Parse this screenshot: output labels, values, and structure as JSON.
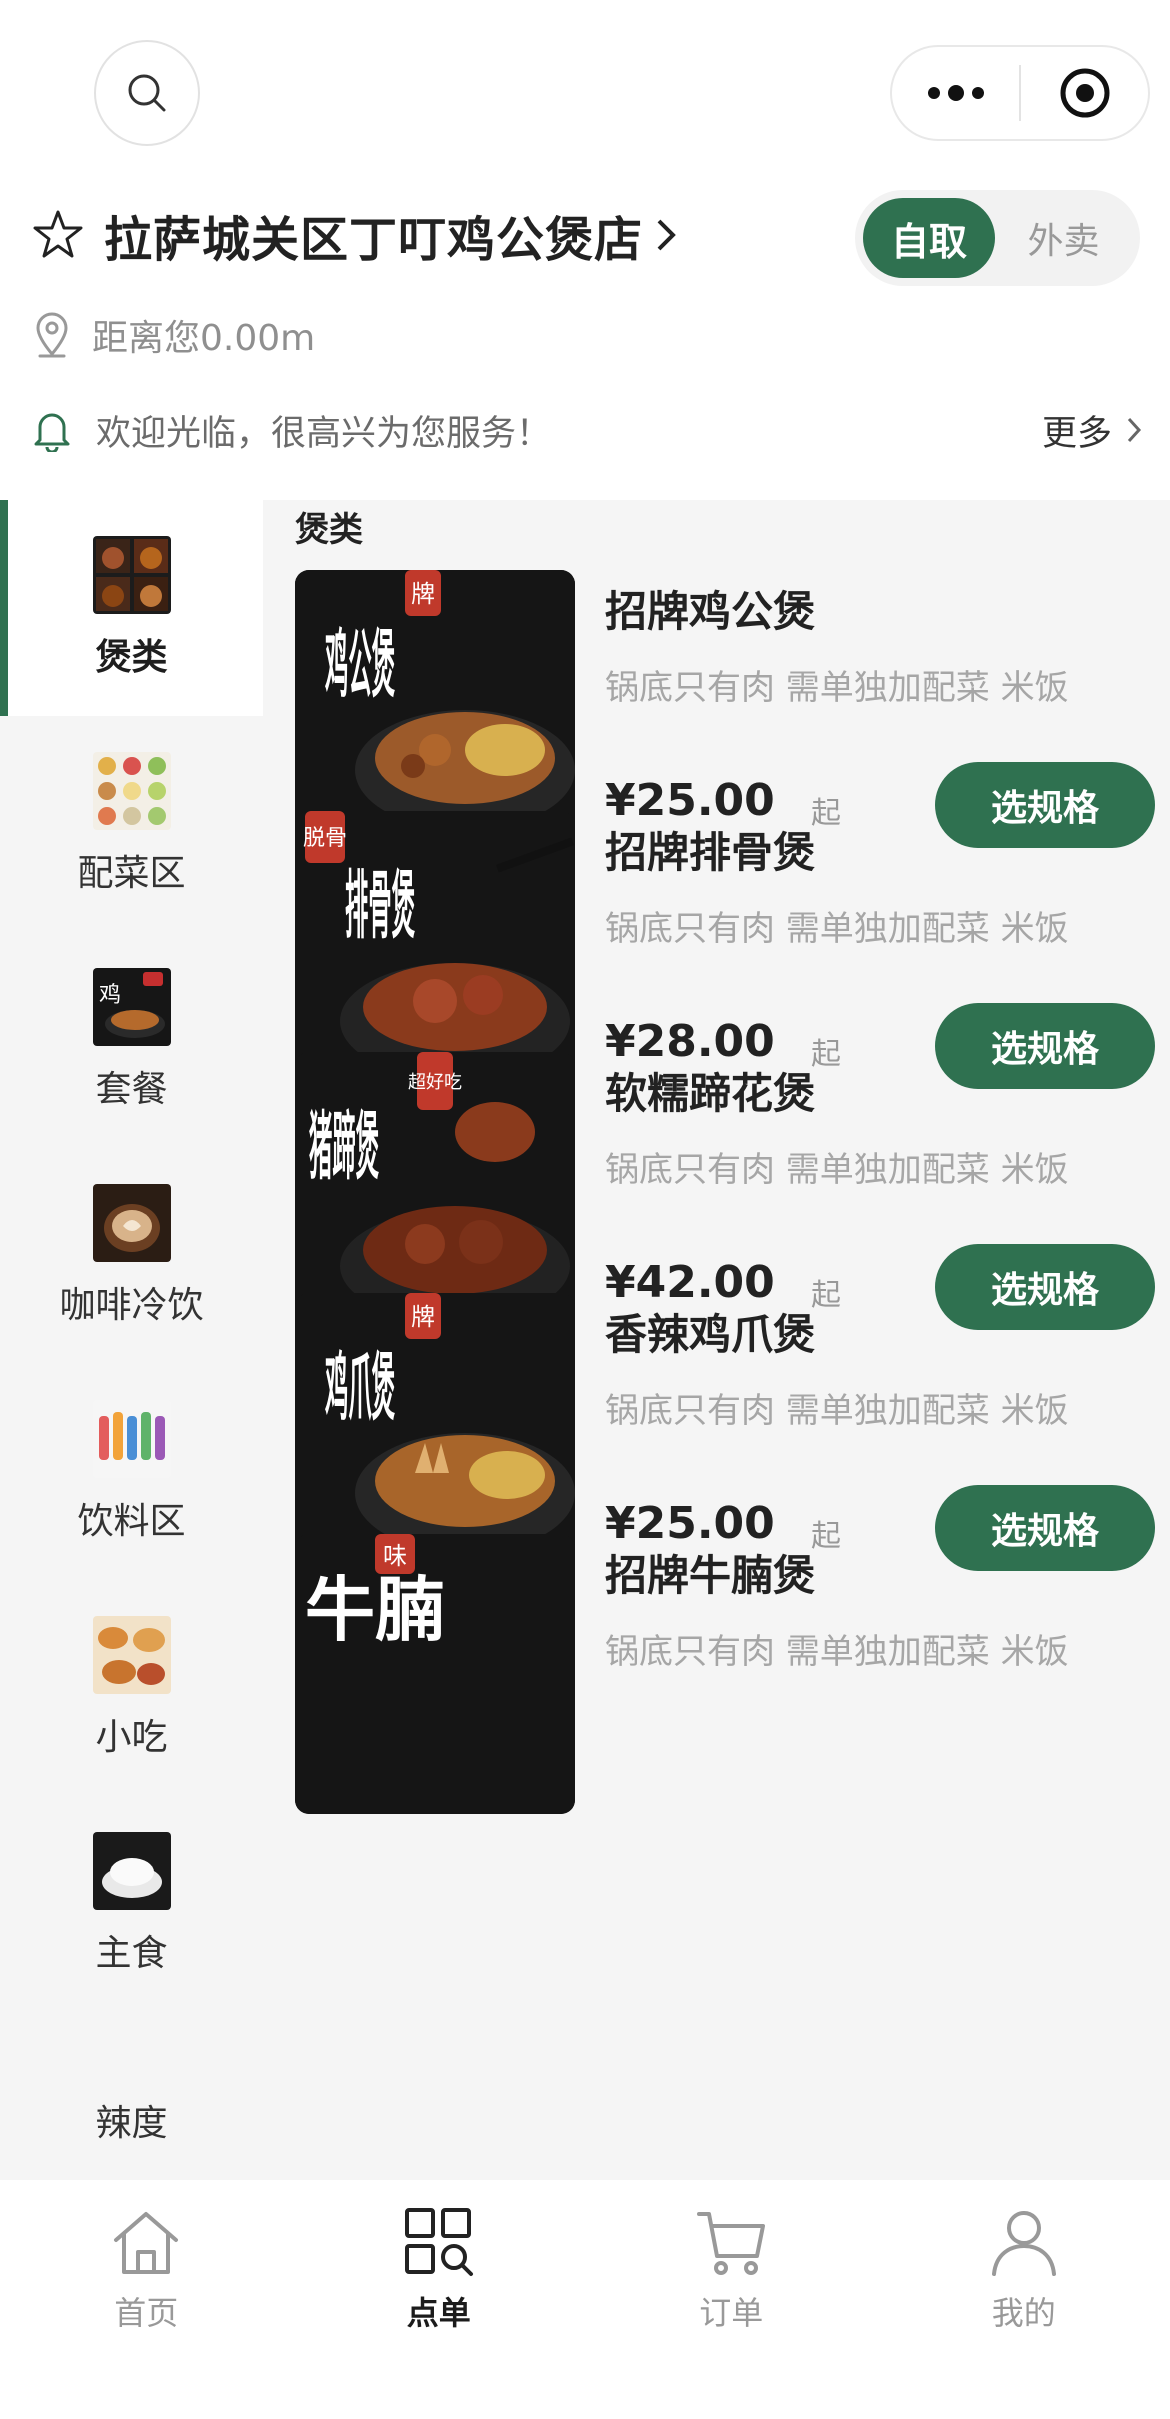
{
  "header": {
    "store_name": "拉萨城关区丁叮鸡公煲店",
    "distance": "距离您0.00m",
    "notice": "欢迎光临，很高兴为您服务！",
    "more": "更多",
    "mode_active": "自取",
    "mode_inactive": "外卖"
  },
  "sidebar": {
    "items": [
      {
        "label": "煲类",
        "active": true
      },
      {
        "label": "配菜区"
      },
      {
        "label": "套餐"
      },
      {
        "label": "咖啡冷饮"
      },
      {
        "label": "饮料区"
      },
      {
        "label": "小吃"
      },
      {
        "label": "主食"
      },
      {
        "label": "辣度"
      }
    ]
  },
  "content": {
    "category_title": "煲类",
    "spec_label": "选规格",
    "from_label": "起",
    "products": [
      {
        "name": "招牌鸡公煲",
        "desc": "锅底只有肉 需单独加配菜 米饭",
        "price": "¥25.00",
        "img_text": "鸡公煲",
        "badge": "牌"
      },
      {
        "name": "招牌排骨煲",
        "desc": "锅底只有肉 需单独加配菜 米饭",
        "price": "¥28.00",
        "img_text": "排骨煲",
        "badge": "脱骨"
      },
      {
        "name": "软糯蹄花煲",
        "desc": "锅底只有肉 需单独加配菜 米饭",
        "price": "¥42.00",
        "img_text": "猪蹄煲",
        "badge": "超好吃"
      },
      {
        "name": "香辣鸡爪煲",
        "desc": "锅底只有肉 需单独加配菜 米饭",
        "price": "¥25.00",
        "img_text": "鸡爪煲",
        "badge": "牌"
      },
      {
        "name": "招牌牛腩煲",
        "desc": "锅底只有肉 需单独加配菜 米饭",
        "price": "",
        "img_text": "牛腩",
        "badge": "味"
      }
    ]
  },
  "tabbar": {
    "tabs": [
      {
        "label": "首页"
      },
      {
        "label": "点单",
        "active": true
      },
      {
        "label": "订单"
      },
      {
        "label": "我的"
      }
    ]
  },
  "colors": {
    "accent": "#2f7150",
    "text": "#222222",
    "muted": "#a6a6a6",
    "background": "#f5f5f5"
  }
}
